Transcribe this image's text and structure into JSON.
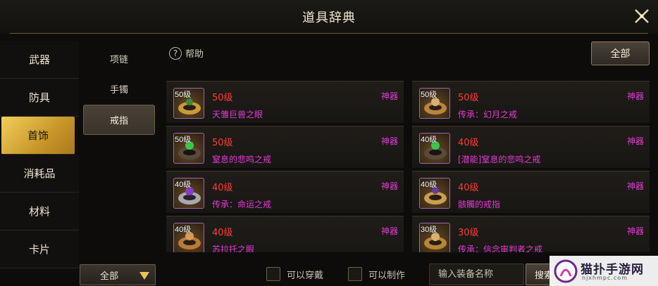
{
  "header": {
    "title": "道具辞典"
  },
  "left_nav": [
    {
      "label": "武器"
    },
    {
      "label": "防具"
    },
    {
      "label": "首饰",
      "active": true
    },
    {
      "label": "消耗品"
    },
    {
      "label": "材料"
    },
    {
      "label": "卡片"
    }
  ],
  "sub_nav": [
    {
      "label": "项链"
    },
    {
      "label": "手镯"
    },
    {
      "label": "戒指",
      "active": true
    }
  ],
  "help": {
    "icon": "question-circle-icon",
    "label": "帮助"
  },
  "filter_all_label": "全部",
  "items": [
    {
      "badge": "50级",
      "level": "50级",
      "name": "天雏巨兽之眼",
      "grade": "神器"
    },
    {
      "badge": "50级",
      "level": "50级",
      "name": "传承：幻月之戒",
      "grade": "神器"
    },
    {
      "badge": "50级",
      "level": "50级",
      "name": "窒息的悲鸣之戒",
      "grade": "神器"
    },
    {
      "badge": "40级",
      "level": "40级",
      "name": "[潜能]窒息的悲鸣之戒",
      "grade": "神器"
    },
    {
      "badge": "40级",
      "level": "40级",
      "name": "传承：命运之戒",
      "grade": "神器"
    },
    {
      "badge": "40级",
      "level": "40级",
      "name": "骸髑的戒指",
      "grade": "神器"
    },
    {
      "badge": "40级",
      "level": "40级",
      "name": "苏拉托之眼",
      "grade": "神器"
    },
    {
      "badge": "30级",
      "level": "30级",
      "name": "传承：信念审判者之戒",
      "grade": "神器"
    }
  ],
  "bottom": {
    "select_value": "全部",
    "checkbox_wearable": "可以穿戴",
    "checkbox_craftable": "可以制作",
    "search_placeholder": "输入装备名称",
    "search_button": "搜索"
  },
  "watermark": {
    "text": "猫扑手游网",
    "url": "njxhmpc.com"
  },
  "colors": {
    "accent_gold": "#e8c45a",
    "level_red": "#ff3a3a",
    "artifact_magenta": "#e23bd6"
  }
}
